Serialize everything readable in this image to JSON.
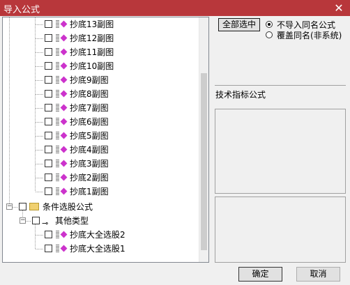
{
  "window": {
    "title": "导入公式",
    "close_glyph": "✕"
  },
  "tree": {
    "items": [
      {
        "label": "抄底13副图"
      },
      {
        "label": "抄底12副图"
      },
      {
        "label": "抄底11副图"
      },
      {
        "label": "抄底10副图"
      },
      {
        "label": "抄底9副图"
      },
      {
        "label": "抄底8副图"
      },
      {
        "label": "抄底7副图"
      },
      {
        "label": "抄底6副图"
      },
      {
        "label": "抄底5副图"
      },
      {
        "label": "抄底4副图"
      },
      {
        "label": "抄底3副图"
      },
      {
        "label": "抄底2副图"
      },
      {
        "label": "抄底1副图"
      }
    ],
    "group": {
      "label": "条件选股公式",
      "expander": "−"
    },
    "subgroup": {
      "label": "其他类型",
      "expander": "−"
    },
    "sub_items": [
      {
        "label": "抄底大全选股2"
      },
      {
        "label": "抄底大全选股1"
      }
    ]
  },
  "options": {
    "select_all_label": "全部选中",
    "radio_no_import": "不导入同名公式",
    "radio_overwrite": "覆盖同名(非系统)",
    "selected": "no_import"
  },
  "section_label": "技术指标公式",
  "buttons": {
    "ok": "确定",
    "cancel": "取消"
  },
  "colors": {
    "titlebar": "#b8373b",
    "diamond": "#cc33cc",
    "folder": "#f0d070"
  }
}
